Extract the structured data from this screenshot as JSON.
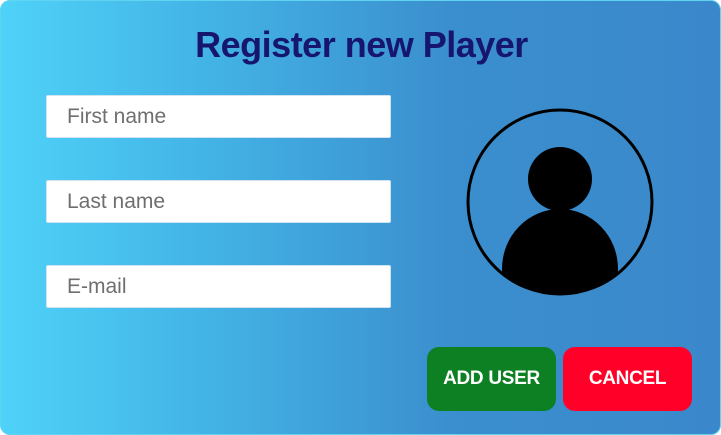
{
  "dialog": {
    "title": "Register new Player"
  },
  "form": {
    "first_name": {
      "value": "",
      "placeholder": "First name"
    },
    "last_name": {
      "value": "",
      "placeholder": "Last name"
    },
    "email": {
      "value": "",
      "placeholder": "E-mail"
    }
  },
  "avatar": {
    "icon": "user-avatar-icon"
  },
  "actions": {
    "add_label": "ADD USER",
    "cancel_label": "CANCEL"
  },
  "colors": {
    "title": "#16166e",
    "add_button": "#0c8022",
    "cancel_button": "#ff0028",
    "gradient_start": "#4fd2f8",
    "gradient_end": "#3a88cb"
  }
}
